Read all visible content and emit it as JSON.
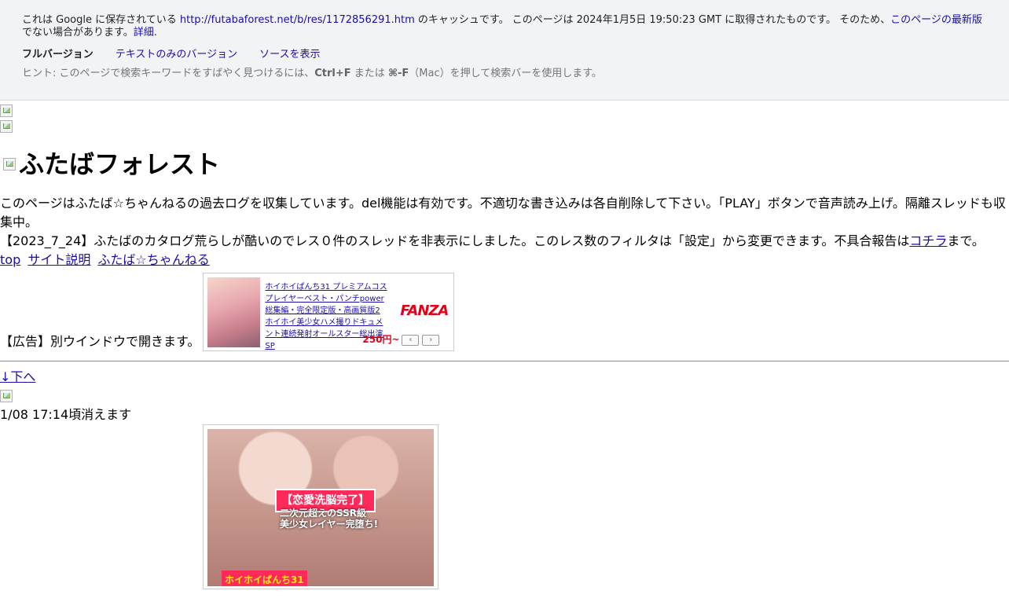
{
  "cache_banner": {
    "prefix": "これは Google に保存されている ",
    "url": "http://futabaforest.net/b/res/1172856291.htm",
    "middle": " のキャッシュです。 このページは 2024年1月5日 19:50:23 GMT に取得されたものです。 そのため、",
    "latest_link": "このページの最新版",
    "suffix": "でない場合があります。",
    "details_link": "詳細",
    "details_suffix": ".",
    "full_version": "フルバージョン",
    "text_only": "テキストのみのバージョン",
    "view_source": "ソースを表示",
    "hint_prefix": "ヒント: このページで検索キーワードをすばやく見つけるには、",
    "hint_key1": "Ctrl+F",
    "hint_mid": " または ",
    "hint_key2": "⌘-F",
    "hint_suffix": "（Mac）を押して検索バーを使用します。"
  },
  "site": {
    "title": "ふたばフォレスト",
    "description": "このページはふたば☆ちゃんねるの過去ログを収集しています。del機能は有効です。不適切な書き込みは各自削除して下さい。「PLAY」ボタンで音声読み上げ。隔離スレッドも収集中。",
    "notice_prefix": "【2023_7_24】ふたばのカタログ荒らしが酷いのでレス０件のスレッドを非表示にしました。このレス数のフィルタは「設定」から変更できます。不具合報告は",
    "notice_link": "コチラ",
    "notice_suffix": "まで。",
    "nav": [
      "top",
      "サイト説明",
      "ふたば☆ちゃんねる"
    ]
  },
  "ad": {
    "label": "【広告】別ウインドウで開きます。",
    "text": "ホイホイぱんち31 プレミアムコスプレイヤーベスト・パンチpower総集編・完全限定版・高画質版2 ホイホイ美少女ハメ撮りドキュメント連続発射オールスター総出演SP",
    "logo": "FANZA",
    "price": "250円~",
    "prev": "‹",
    "next": "›"
  },
  "thread": {
    "down_link": "↓下へ",
    "expire": "1/08 17:14頃消えます",
    "promo_title": "【恋愛洗脳完了】",
    "promo_sub": "二次元超えのSSR級\n美少女レイヤー完堕ち!",
    "promo_bottom": "ホイホイぱんち31"
  }
}
